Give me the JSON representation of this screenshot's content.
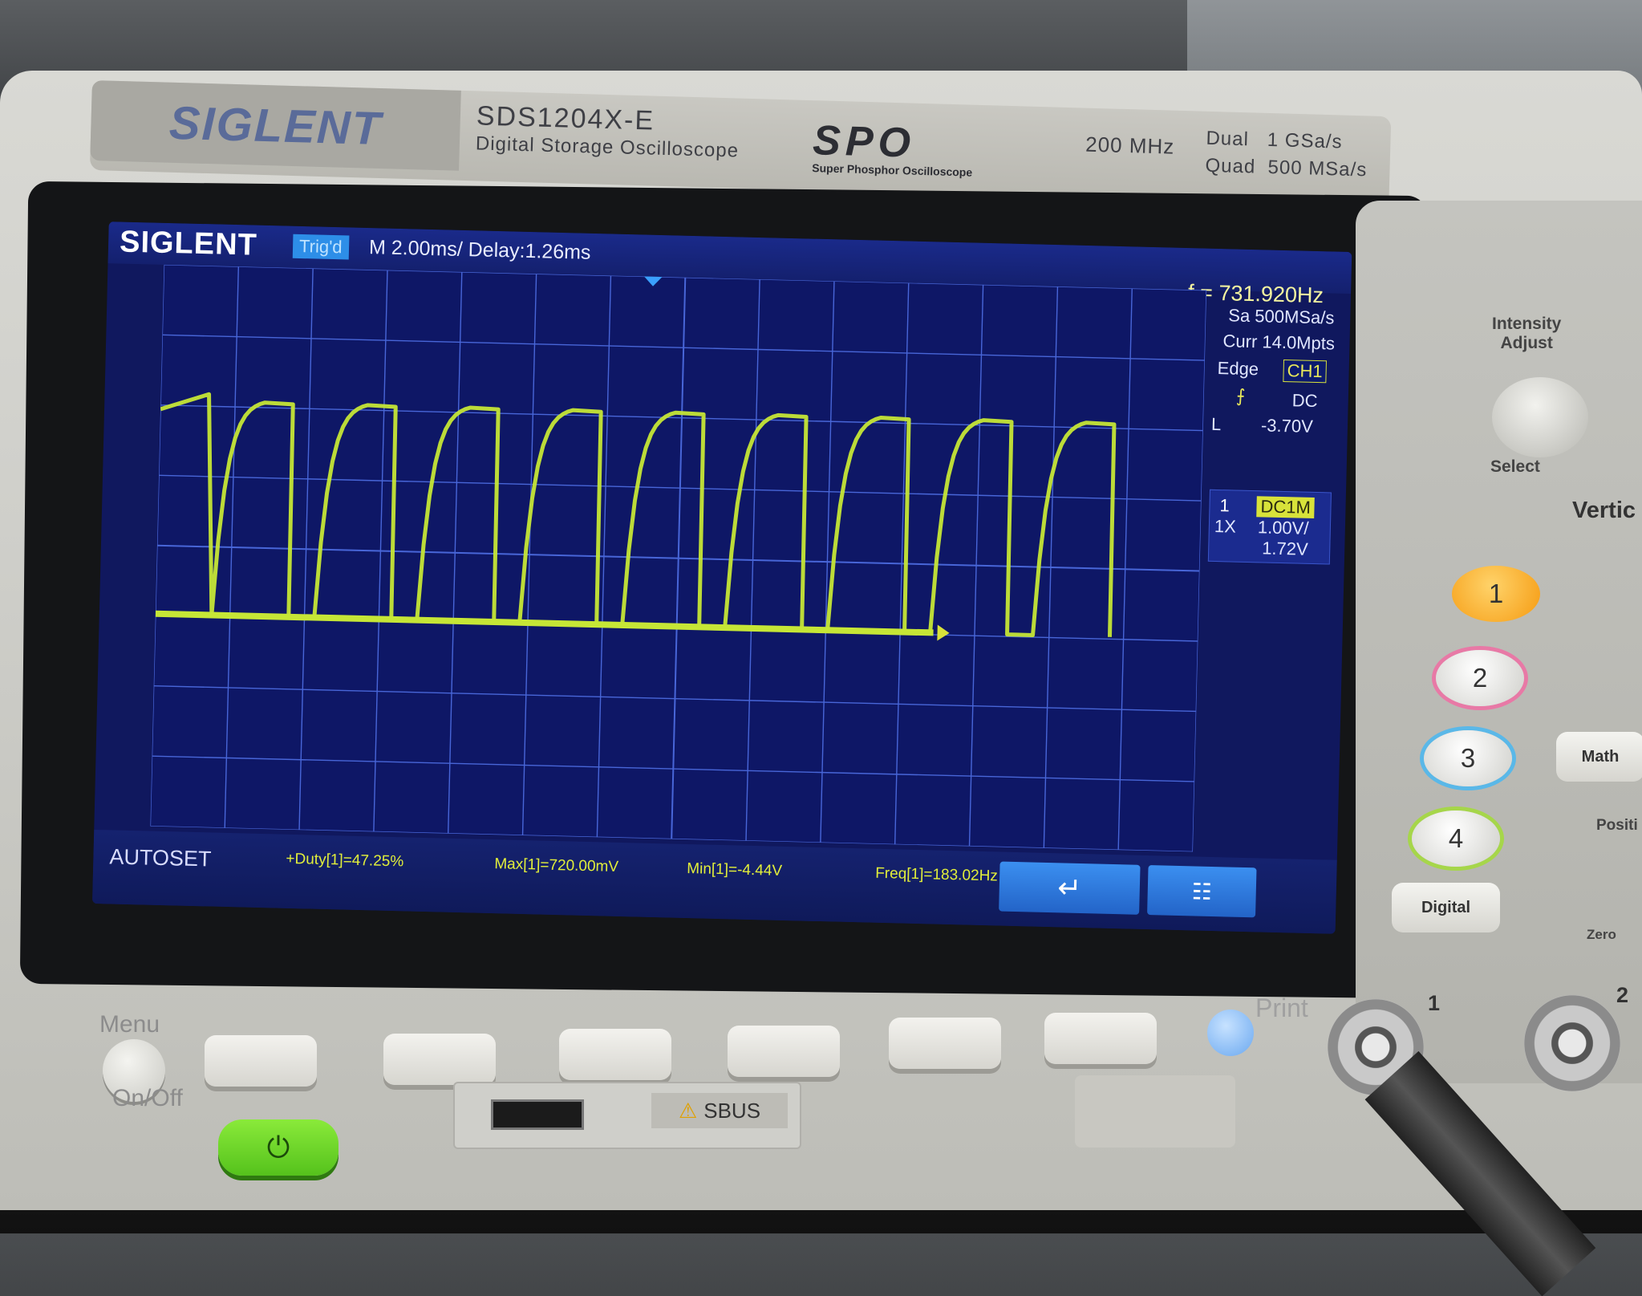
{
  "instrument": {
    "brand": "SIGLENT",
    "model": "SDS1204X-E",
    "description": "Digital Storage Oscilloscope",
    "spo": "SPO",
    "spo_sub": "Super Phosphor Oscilloscope",
    "bandwidth": "200 MHz",
    "sample_dual": "Dual   1 GSa/s",
    "sample_quad": "Quad  500 MSa/s"
  },
  "screen": {
    "logo": "SIGLENT",
    "trigger_status": "Trig'd",
    "timebase": "M 2.00ms/ Delay:1.26ms",
    "frequency": "f = 731.920Hz",
    "sample_rate": "Sa 500MSa/s",
    "memory": "Curr 14.0Mpts",
    "trigger_type": "Edge",
    "trigger_source": "CH1",
    "trigger_coupling": "DC",
    "trigger_level_label": "L",
    "trigger_level": "-3.70V",
    "channel_number": "1",
    "channel_coupling": "DC1M",
    "probe": "1X",
    "volts_div": "1.00V/",
    "offset": "1.72V",
    "ch1_marker": "1",
    "bottom_label": "AUTOSET",
    "measurements": [
      "+Duty[1]=47.25%",
      "Max[1]=720.00mV",
      "Min[1]=-4.44V",
      "Freq[1]=183.02Hz"
    ],
    "trace_color": "#c6e636"
  },
  "front_panel": {
    "menu": "Menu",
    "on_off": "On/Off",
    "print": "Print",
    "sbus": "SBUS",
    "intensity": "Intensity\nAdjust",
    "select": "Select",
    "vertical": "Vertic",
    "channels": [
      "1",
      "2",
      "3",
      "4"
    ],
    "channel_colors": [
      "#f5a21c",
      "#e879a6",
      "#5ab8e8",
      "#a6d64a"
    ],
    "math": "Math",
    "digital": "Digital",
    "position": "Positi",
    "zero": "Zero",
    "bnc_labels": [
      "1",
      "2"
    ]
  }
}
